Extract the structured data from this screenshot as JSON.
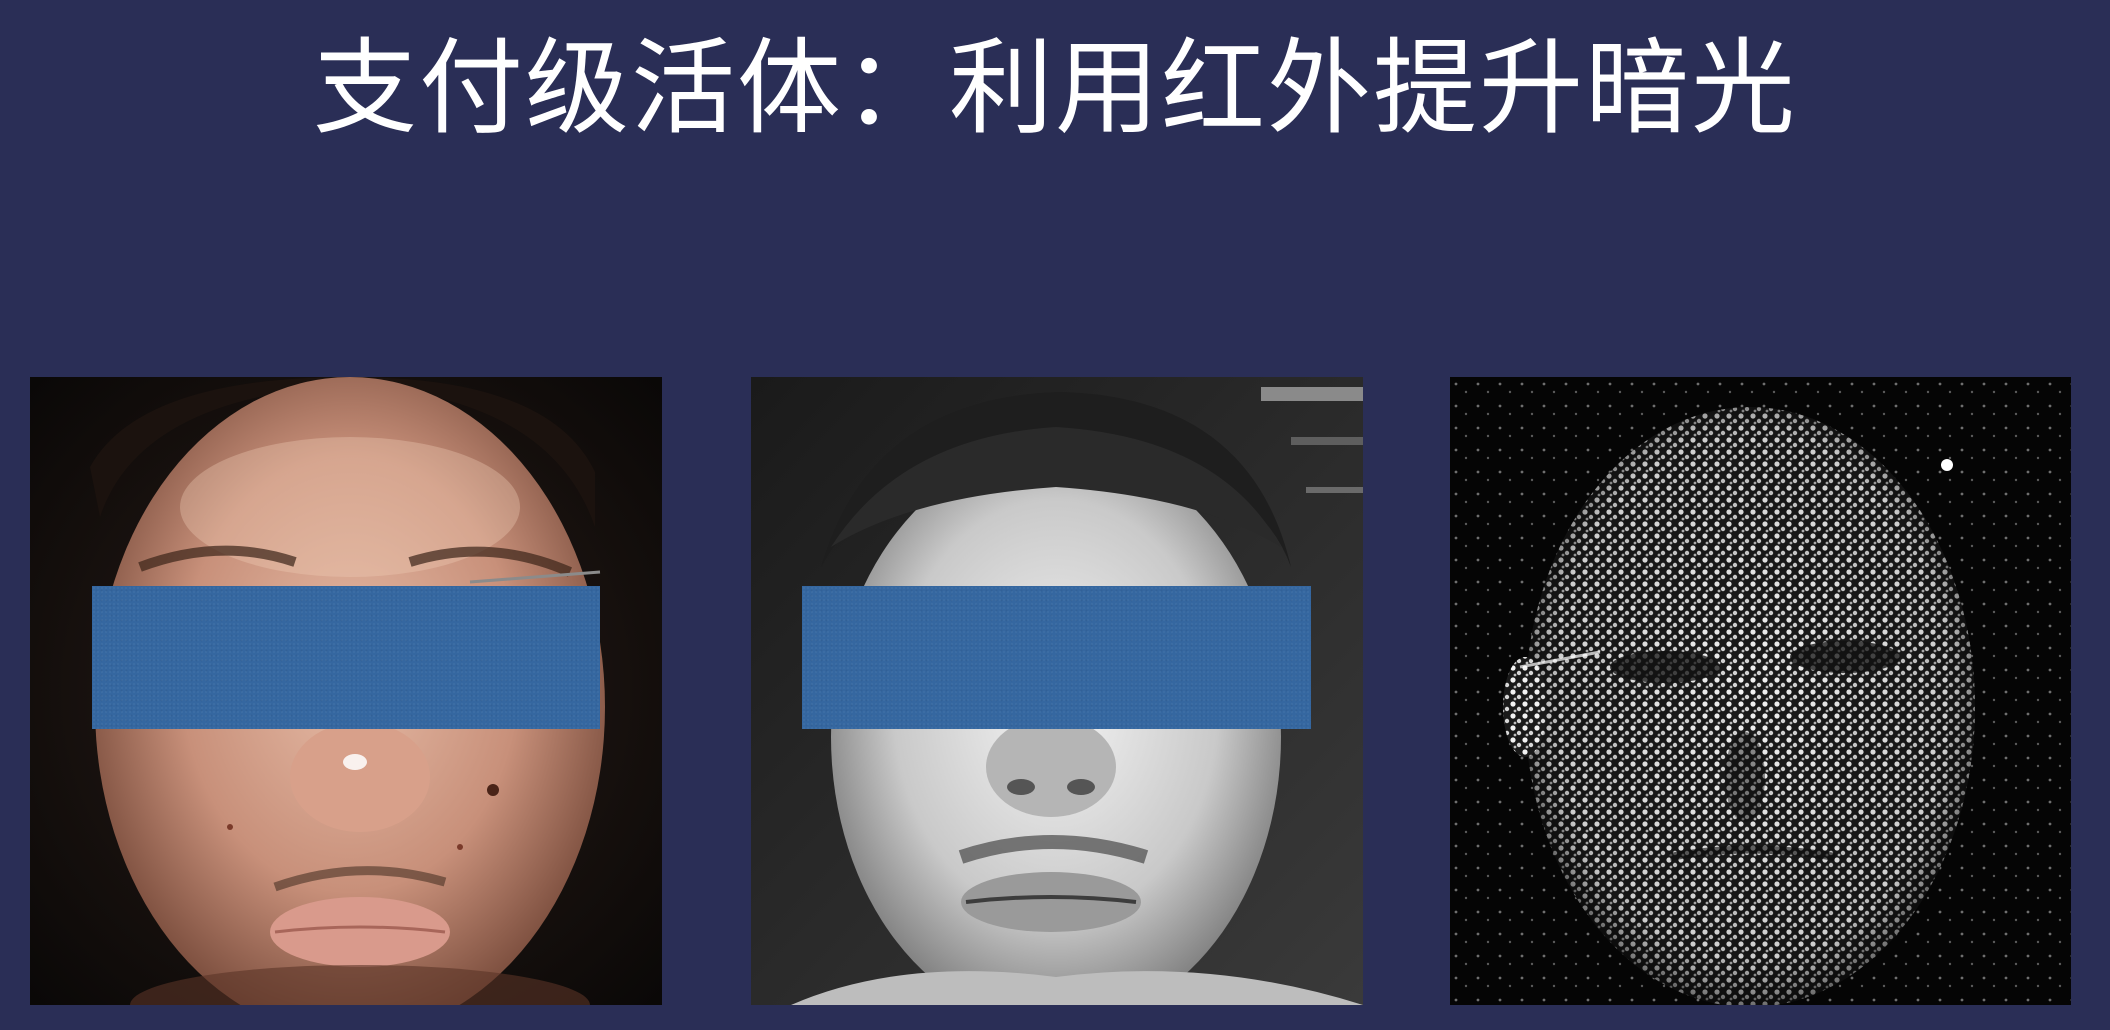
{
  "slide": {
    "title": "支付级活体：利用红外提升暗光"
  },
  "images": [
    {
      "kind": "rgb-face-photo",
      "privacy_mask": true
    },
    {
      "kind": "infrared-face-photo",
      "privacy_mask": true
    },
    {
      "kind": "structured-light-dot-pattern-photo",
      "privacy_mask": false
    }
  ],
  "colors": {
    "background": "#2a2e56",
    "title_text": "#ffffff",
    "privacy_mask": "#3567a0"
  }
}
